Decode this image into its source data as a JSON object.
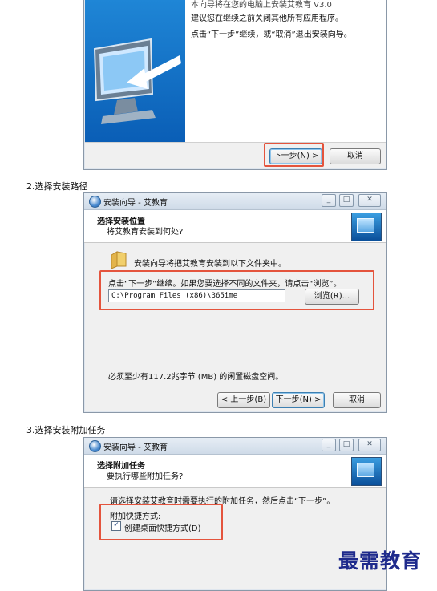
{
  "dialog1": {
    "intro_line": "本向导将在您的电脑上安装艾教育 V3.0",
    "line2": "建议您在继续之前关闭其他所有应用程序。",
    "line3": "点击“下一步”继续，或“取消”退出安装向导。",
    "next_button": "下一步(N) >",
    "cancel_button": "取消"
  },
  "step2_heading": "2.选择安装路径",
  "dialog2": {
    "window_title": "安装向导 - 艾教育",
    "header_title": "选择安装位置",
    "header_subtitle": "将艾教育安装到何处?",
    "folder_text": "安装向导将把艾教育安装到以下文件夹中。",
    "instruction": "点击“下一步”继续。如果您要选择不同的文件夹，请点击“浏览”。",
    "path_value": "C:\\Program Files (x86)\\365ime",
    "browse_button": "浏览(R)...",
    "space_note": "必须至少有117.2兆字节 (MB) 的闲置磁盘空间。",
    "back_button": "< 上一步(B)",
    "next_button": "下一步(N) >",
    "cancel_button": "取消"
  },
  "step3_heading": "3.选择安装附加任务",
  "dialog3": {
    "window_title": "安装向导 - 艾教育",
    "header_title": "选择附加任务",
    "header_subtitle": "要执行哪些附加任务?",
    "instruction": "请选择安装艾教育时需要执行的附加任务，然后点击“下一步”。",
    "group_label": "附加快捷方式:",
    "checkbox_label": "创建桌面快捷方式(D)",
    "checkbox_checked": true
  },
  "watermark": "最需教育",
  "colors": {
    "highlight_red": "#e4543d",
    "watermark_blue": "#1e2a8c"
  }
}
